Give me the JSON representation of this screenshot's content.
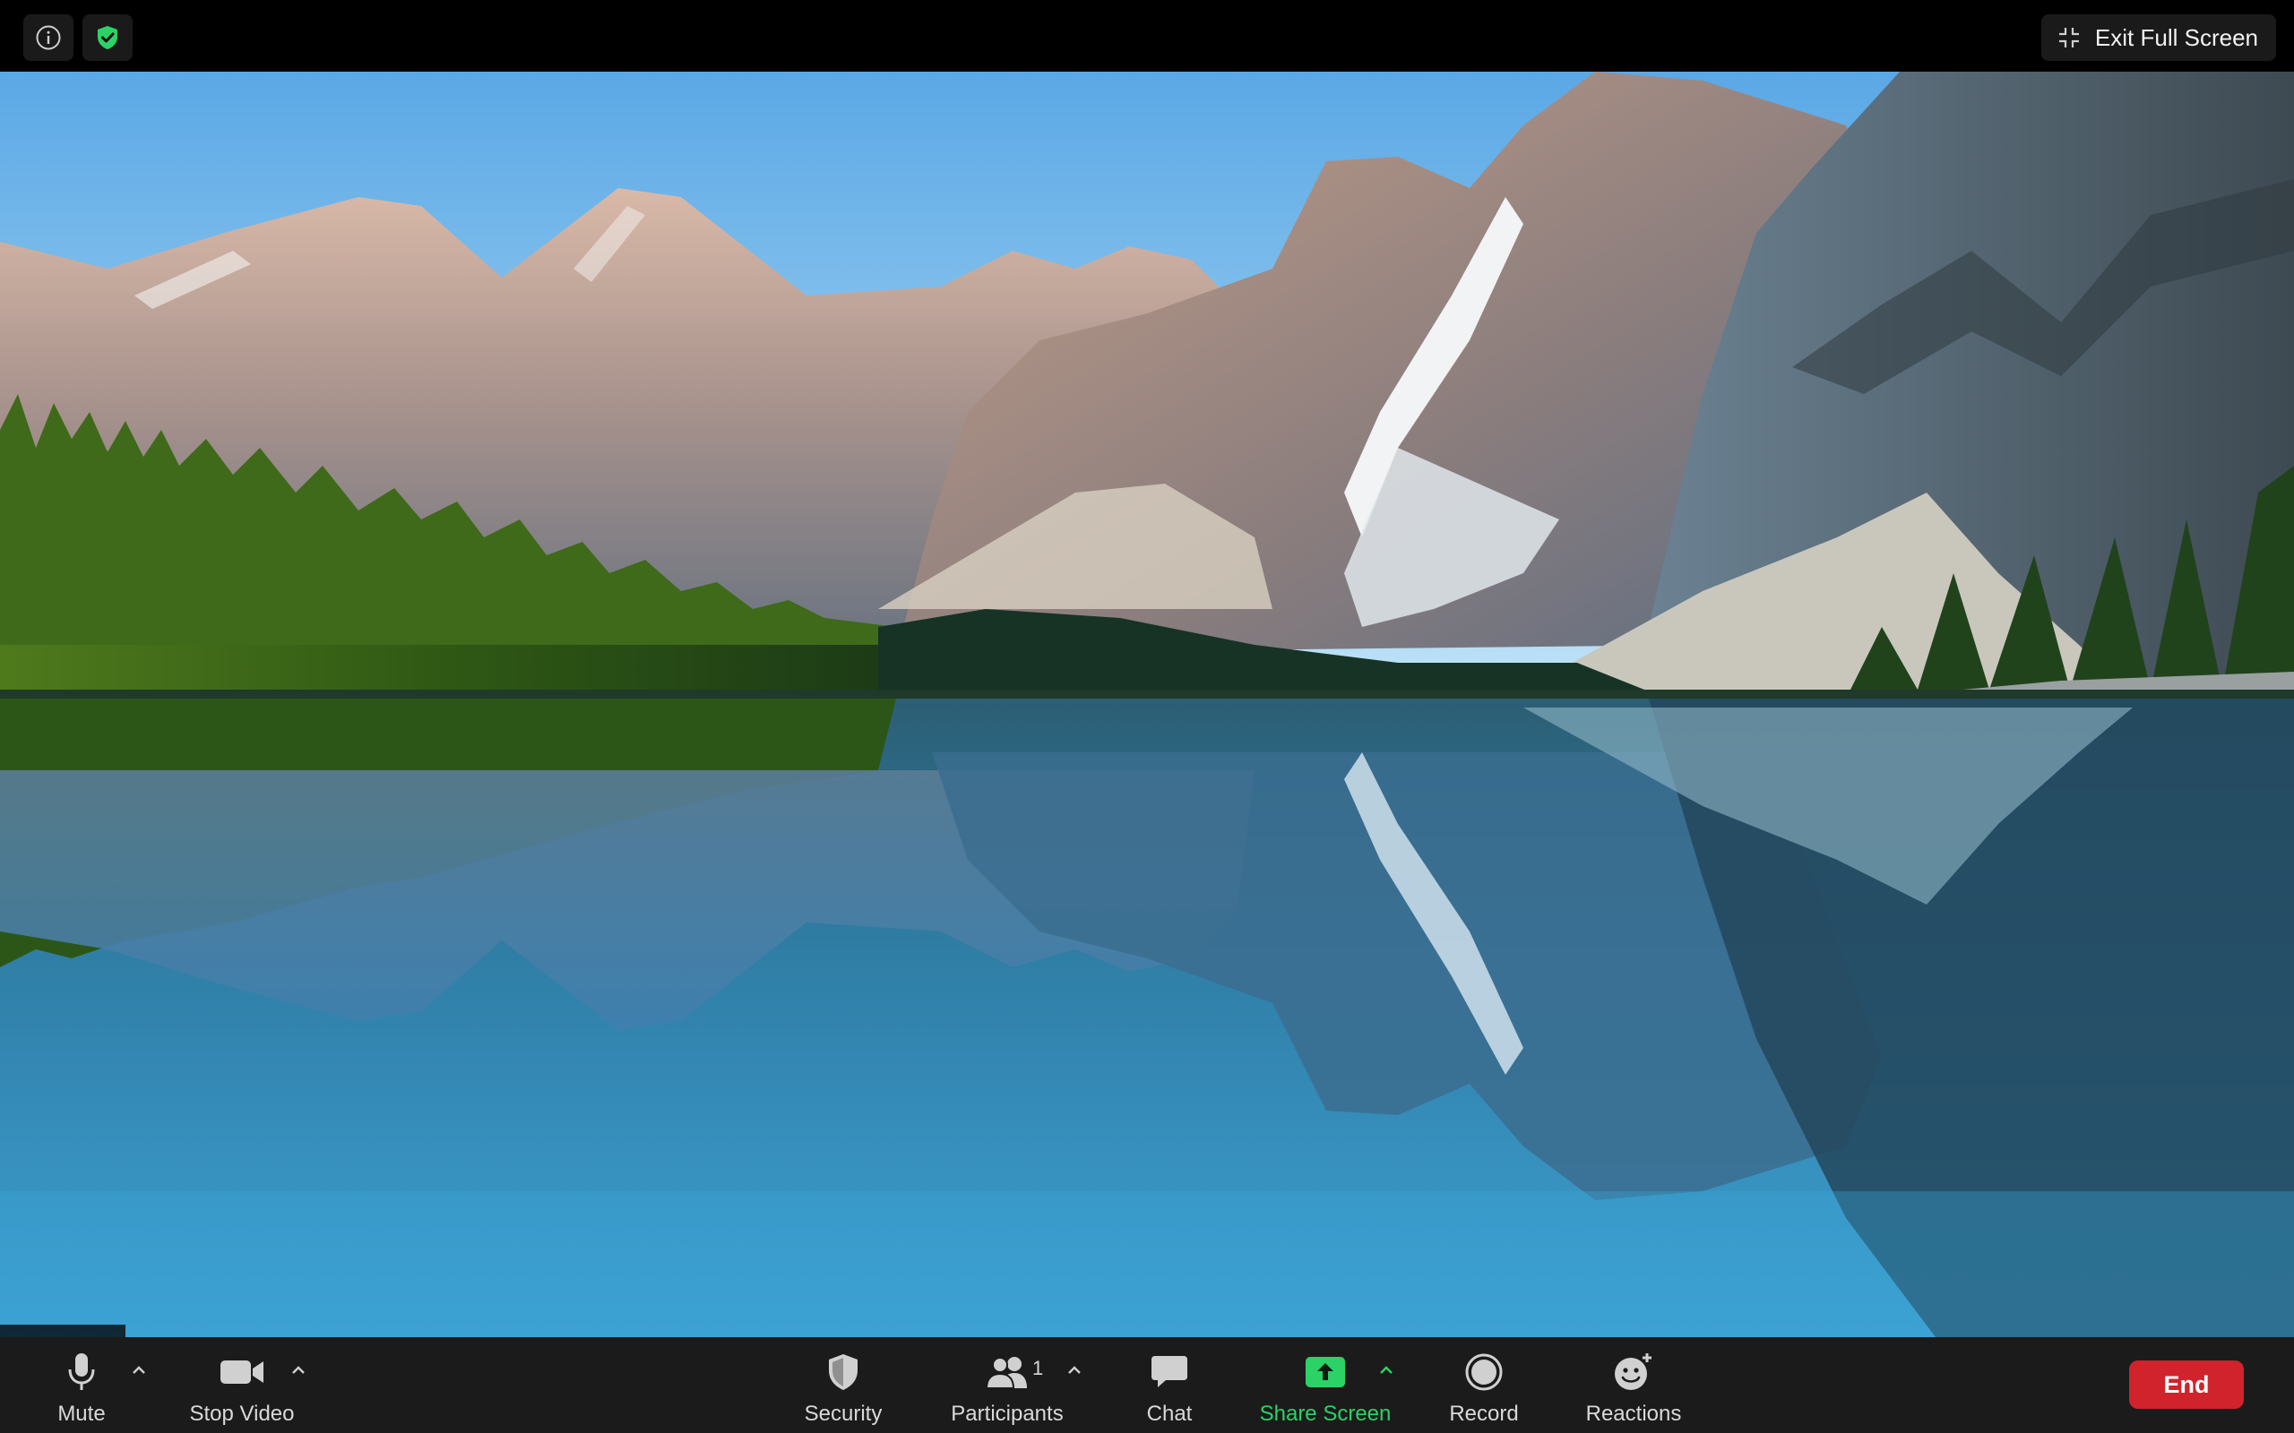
{
  "topbar": {
    "info_icon": "info-circle-icon",
    "security_icon": "green-shield-check-icon",
    "exit_fullscreen_label": "Exit Full Screen"
  },
  "video": {
    "participant_name": "",
    "scene": "mountain-lake-background"
  },
  "toolbar": {
    "mute_label": "Mute",
    "stop_video_label": "Stop Video",
    "security_label": "Security",
    "participants_label": "Participants",
    "participants_count": "1",
    "chat_label": "Chat",
    "share_screen_label": "Share Screen",
    "record_label": "Record",
    "reactions_label": "Reactions",
    "end_label": "End"
  },
  "colors": {
    "share_green": "#2bd265",
    "end_red": "#d0232b",
    "toolbar_bg": "#1b1b1b",
    "topbar_bg": "#000000"
  }
}
